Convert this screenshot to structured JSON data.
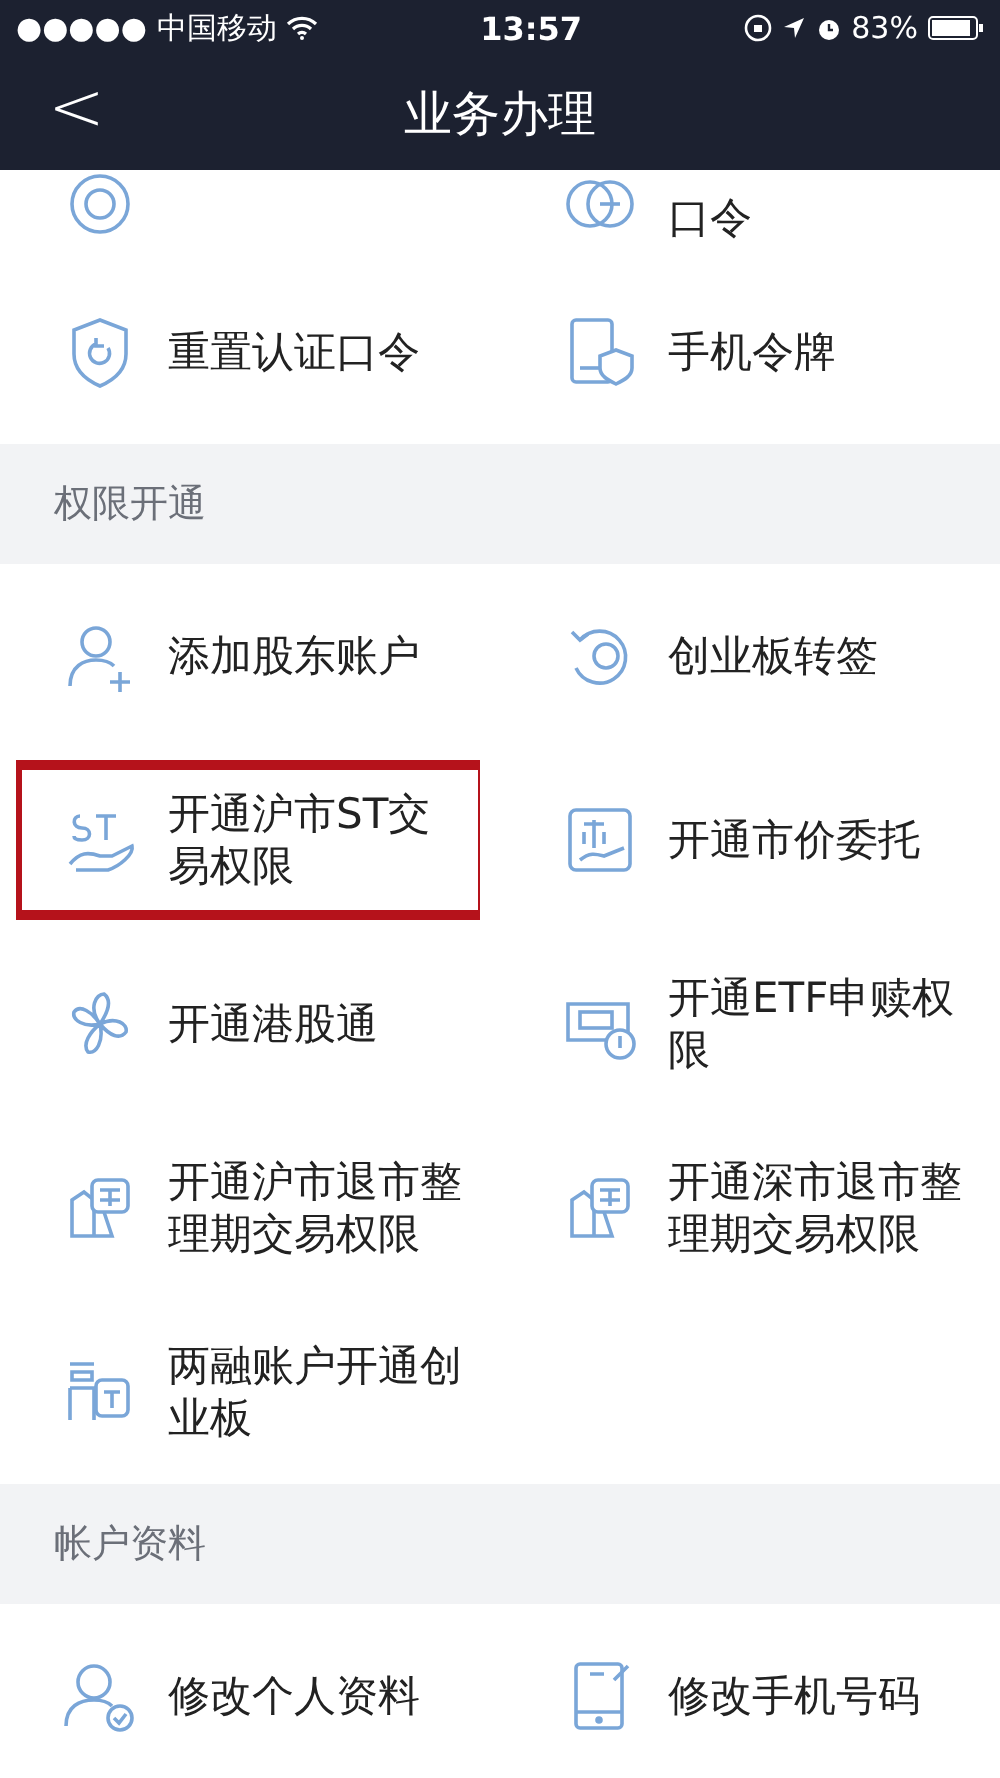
{
  "status_bar": {
    "signal": "●●●●●",
    "carrier": "中国移动",
    "time": "13:57",
    "battery": "83%"
  },
  "nav": {
    "back": "<",
    "title": "业务办理"
  },
  "sections": [
    {
      "cut": true,
      "rows": [
        [
          {
            "highlighted": false
          },
          {
            "label": "口令",
            "highlighted": false
          }
        ]
      ]
    },
    {
      "cut": false,
      "rows": [
        [
          {
            "label": "重置认证口令",
            "highlighted": false
          },
          {
            "label": "手机令牌",
            "highlighted": false
          }
        ]
      ]
    },
    {
      "title": "权限开通",
      "cut": false,
      "rows": [
        [
          {
            "label": "添加股东账户",
            "highlighted": false
          },
          {
            "label": "创业板转签",
            "highlighted": false
          }
        ],
        [
          {
            "label": "开通沪市ST交易权限",
            "highlighted": true
          },
          {
            "label": "开通市价委托",
            "highlighted": false
          }
        ],
        [
          {
            "label": "开通港股通",
            "highlighted": false
          },
          {
            "label": "开通ETF申赎权限",
            "highlighted": false
          }
        ],
        [
          {
            "label": "开通沪市退市整理期交易权限",
            "highlighted": false
          },
          {
            "label": "开通深市退市整理期交易权限",
            "highlighted": false
          }
        ],
        [
          {
            "label": "两融账户开通创业板",
            "highlighted": false
          }
        ]
      ]
    },
    {
      "title": "帐户资料",
      "cut": false,
      "rows": [
        [
          {
            "label": "修改个人资料",
            "highlighted": false
          },
          {
            "label": "修改手机号码",
            "highlighted": false
          }
        ]
      ]
    }
  ]
}
